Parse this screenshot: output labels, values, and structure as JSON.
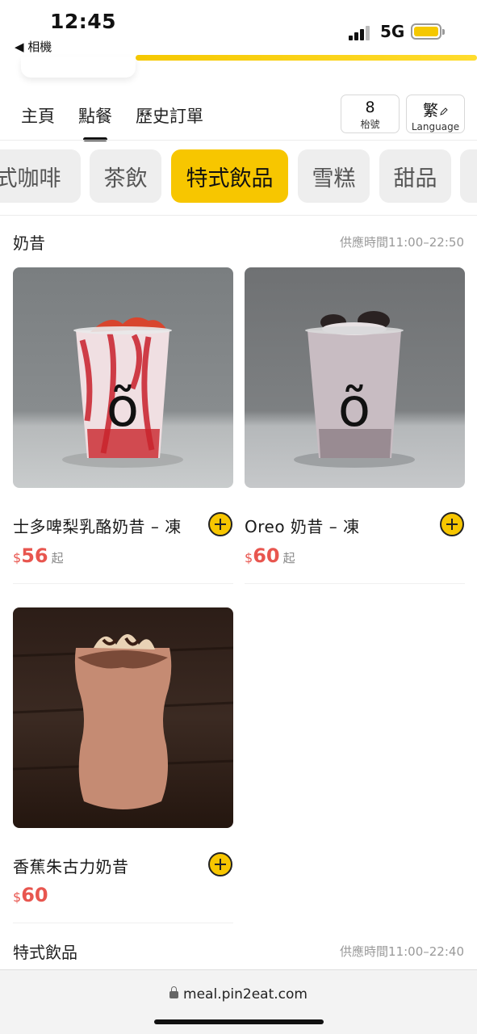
{
  "status_bar": {
    "time": "12:45",
    "back_label": "◀ 相機",
    "network": "5G"
  },
  "nav": {
    "tabs": [
      {
        "label": "主頁"
      },
      {
        "label": "點餐"
      },
      {
        "label": "歷史訂單"
      }
    ],
    "active_tab": "點餐",
    "table_number": "8",
    "table_label": "枱號",
    "language_char": "繁",
    "language_label": "Language"
  },
  "categories": [
    {
      "label": "式咖啡"
    },
    {
      "label": "茶飲"
    },
    {
      "label": "特式飲品"
    },
    {
      "label": "雪糕"
    },
    {
      "label": "甜品"
    }
  ],
  "active_category": "特式飲品",
  "sections": [
    {
      "title": "奶昔",
      "hours": "供應時間11:00–22:50",
      "items": [
        {
          "name": "士多啤梨乳酪奶昔 – 凍",
          "currency": "$",
          "price": "56",
          "suffix": "起"
        },
        {
          "name": "Oreo 奶昔 – 凍",
          "currency": "$",
          "price": "60",
          "suffix": "起"
        },
        {
          "name": "香蕉朱古力奶昔",
          "currency": "$",
          "price": "60",
          "suffix": ""
        }
      ]
    },
    {
      "title": "特式飲品",
      "hours": "供應時間11:00–22:40"
    }
  ],
  "cup_logo": "õ",
  "browser": {
    "url": "meal.pin2eat.com"
  },
  "colors": {
    "accent": "#f7c600",
    "price": "#e8564f"
  }
}
